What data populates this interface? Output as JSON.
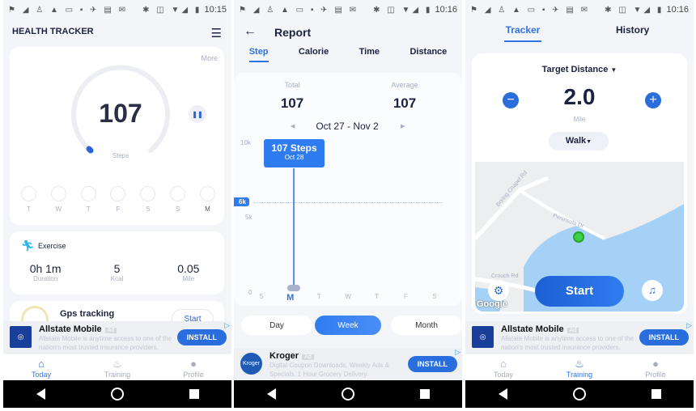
{
  "screens": [
    {
      "time": "10:15",
      "title": "HEALTH TRACKER",
      "more": "More",
      "steps": "107",
      "steps_label": "Steps",
      "step_progress": 0.01,
      "days": [
        "T",
        "W",
        "T",
        "F",
        "S",
        "S",
        "M"
      ],
      "exercise": {
        "title": "Exercise",
        "stats": [
          {
            "value": "0h 1m",
            "label": "Duration"
          },
          {
            "value": "5",
            "label": "Kcal"
          },
          {
            "value": "0.05",
            "label": "Mile"
          }
        ]
      },
      "gps": {
        "title": "Gps tracking",
        "button": "Start"
      },
      "ad": {
        "title": "Allstate Mobile",
        "badge": "Ad",
        "desc": "Allstate Mobile is anytime access to one of the nation's most trusted insurance providers.",
        "button": "INSTALL"
      },
      "tabs": [
        "Today",
        "Training",
        "Profile"
      ],
      "active_tab": "Today"
    },
    {
      "time": "10:16",
      "title": "Report",
      "tabs": [
        "Step",
        "Calorie",
        "Time",
        "Distance"
      ],
      "active_tab": "Step",
      "total_label": "Total",
      "total": "107",
      "average_label": "Average",
      "average": "107",
      "range": "Oct 27 - Nov 2",
      "chart": {
        "y_ticks": [
          "10k",
          "5k",
          "0"
        ],
        "goal": "6k",
        "days": [
          "S",
          "M",
          "T",
          "W",
          "T",
          "F",
          "S"
        ],
        "selected_day": "M",
        "values": [
          0,
          107,
          0,
          0,
          0,
          0,
          0
        ],
        "tooltip_value": "107 Steps",
        "tooltip_date": "Oct 28"
      },
      "periods": [
        "Day",
        "Week",
        "Month"
      ],
      "active_period": "Week",
      "ad": {
        "title": "Kroger",
        "badge": "Ad",
        "logo": "Kroger",
        "desc": "Digital Coupon Downloads, Weekly Ads & Specials. 1 Hour Grocery Delivery.",
        "button": "INSTALL"
      }
    },
    {
      "time": "10:16",
      "tabs": [
        "Tracker",
        "History"
      ],
      "active_tab": "Tracker",
      "target_label": "Target Distance",
      "distance": "2.0",
      "unit": "Mile",
      "mode": "Walk",
      "map": {
        "roads": [
          "Boring Chapel Rd",
          "Peninsula Dr",
          "Crouch Rd"
        ],
        "attribution": "Google"
      },
      "start": "Start",
      "ad": {
        "title": "Allstate Mobile",
        "badge": "Ad",
        "desc": "Allstate Mobile is anytime access to one of the nation's most trusted insurance providers.",
        "button": "INSTALL"
      },
      "bottom_tabs": [
        "Today",
        "Training",
        "Profile"
      ],
      "active_bottom": "Training"
    }
  ],
  "colors": {
    "accent": "#2f73e0",
    "background": "#f3f5f9",
    "goal": "#2f7cf0"
  }
}
